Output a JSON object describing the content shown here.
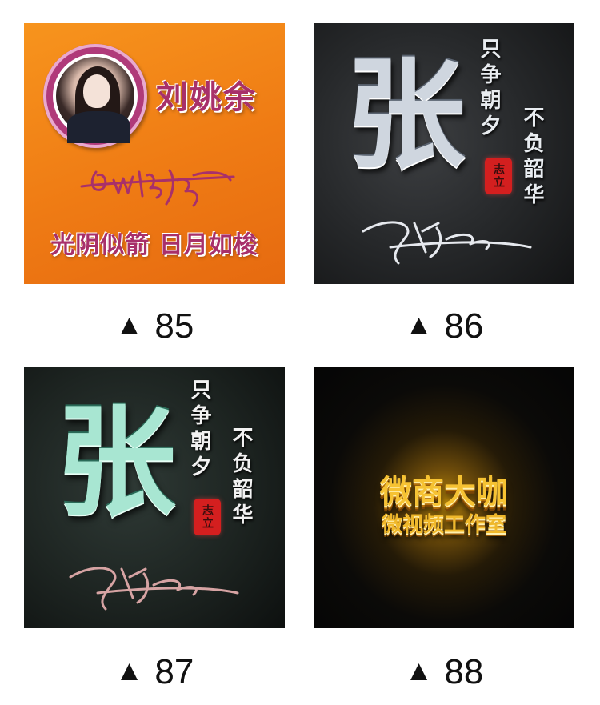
{
  "tiles": [
    {
      "caption": "85",
      "name": "刘姚余",
      "slogan": "光阴似箭 日月如梭"
    },
    {
      "caption": "86",
      "big_char": "张",
      "verse_right": "不负韶华",
      "verse_left": "只争朝夕",
      "seal": "志立"
    },
    {
      "caption": "87",
      "big_char": "张",
      "verse_right": "不负韶华",
      "verse_left": "只争朝夕",
      "seal": "志立"
    },
    {
      "caption": "88",
      "line1": "微商大咖",
      "line2": "微视频工作室"
    }
  ],
  "caption_icon": "▲",
  "colors": {
    "orange_bg": "#f7941d",
    "magenta_text": "#a8306a",
    "gold_text": "#f4c030",
    "seal_red": "#d41f1f"
  },
  "icons": [
    "up-triangle-icon",
    "avatar-photo",
    "signature-graphic"
  ]
}
